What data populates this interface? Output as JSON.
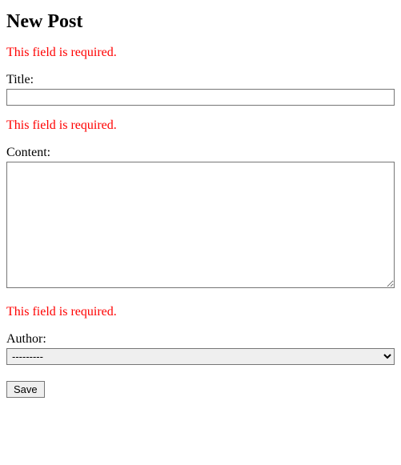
{
  "heading": "New Post",
  "errors": {
    "title": "This field is required.",
    "content": "This field is required.",
    "author": "This field is required."
  },
  "labels": {
    "title": "Title:",
    "content": "Content:",
    "author": "Author:"
  },
  "values": {
    "title": "",
    "content": "",
    "author_selected": "---------"
  },
  "author_options": [
    "---------"
  ],
  "save_label": "Save"
}
